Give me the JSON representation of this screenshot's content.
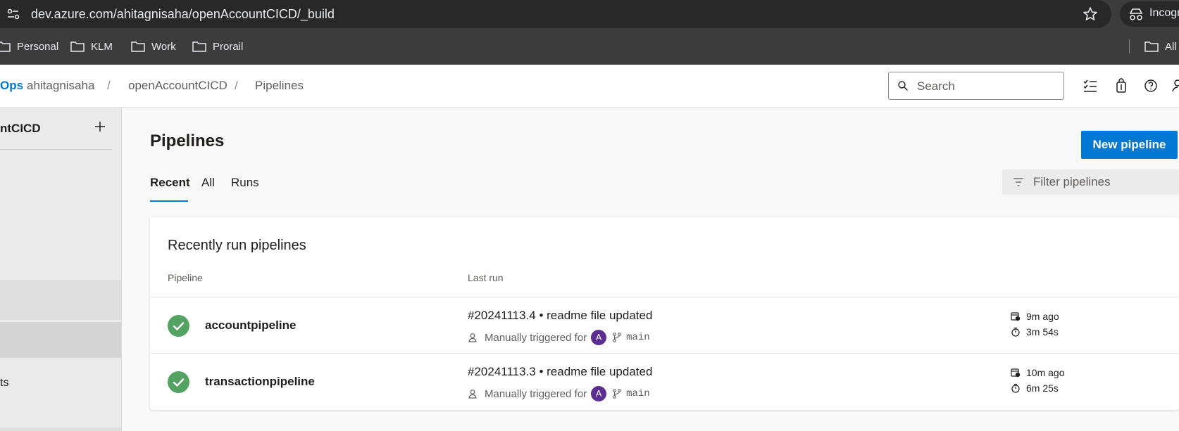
{
  "browser": {
    "url": "dev.azure.com/ahitagnisaha/openAccountCICD/_build",
    "incognito_label": "Incogn"
  },
  "bookmarks": {
    "items": [
      {
        "label": "Personal"
      },
      {
        "label": "KLM"
      },
      {
        "label": "Work"
      },
      {
        "label": "Prorail"
      }
    ],
    "all_label": "All"
  },
  "header": {
    "brand": "Ops",
    "breadcrumb": [
      "ahitagnisaha",
      "openAccountCICD",
      "Pipelines"
    ],
    "search_placeholder": "Search"
  },
  "sidebar": {
    "project_name": "ntCICD",
    "partial_item": "ts"
  },
  "main": {
    "title": "Pipelines",
    "new_pipeline_label": "New pipeline",
    "tabs": [
      "Recent",
      "All",
      "Runs"
    ],
    "filter_placeholder": "Filter pipelines",
    "card_title": "Recently run pipelines",
    "columns": [
      "Pipeline",
      "Last run"
    ],
    "rows": [
      {
        "name": "accountpipeline",
        "status": "succeeded",
        "run": "#20241113.4 • readme file updated",
        "trigger": "Manually triggered for",
        "avatar": "A",
        "branch": "main",
        "when": "9m ago",
        "duration": "3m 54s"
      },
      {
        "name": "transactionpipeline",
        "status": "succeeded",
        "run": "#20241113.3 • readme file updated",
        "trigger": "Manually triggered for",
        "avatar": "A",
        "branch": "main",
        "when": "10m ago",
        "duration": "6m 25s"
      }
    ]
  },
  "colors": {
    "accent": "#0078d4",
    "success": "#55a362",
    "avatar": "#5c2d91"
  }
}
